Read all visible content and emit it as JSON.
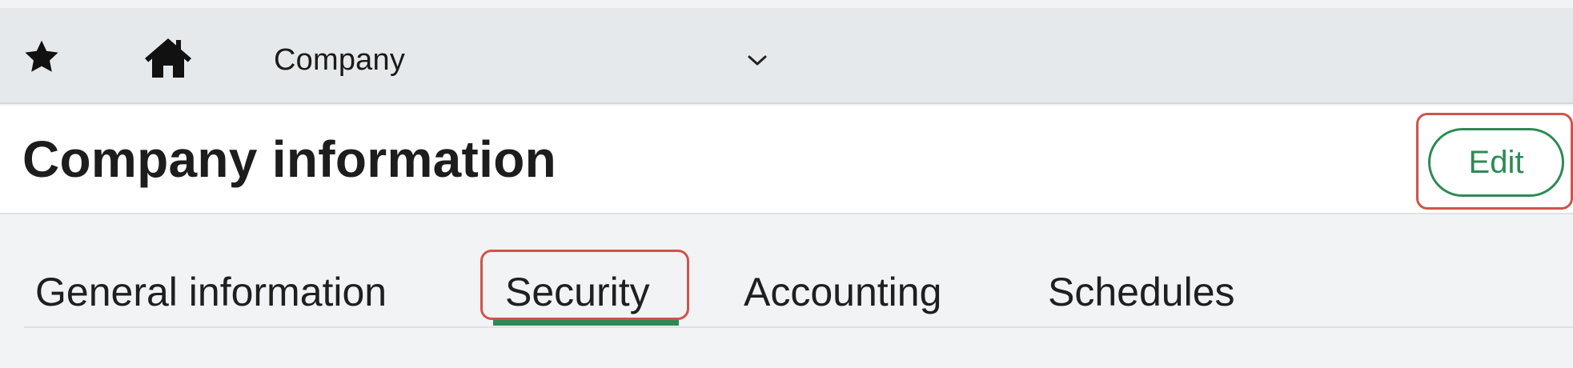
{
  "topbar": {
    "favorite_icon": "star-icon",
    "home_icon": "home-icon",
    "context_label": "Company",
    "dropdown_icon": "chevron-down-icon"
  },
  "header": {
    "title": "Company information",
    "edit_label": "Edit"
  },
  "tabs": [
    {
      "label": "General information",
      "active": false
    },
    {
      "label": "Security",
      "active": true
    },
    {
      "label": "Accounting",
      "active": false
    },
    {
      "label": "Schedules",
      "active": false
    }
  ],
  "colors": {
    "accent": "#2e8a56",
    "highlight": "#d0534b",
    "topbar_bg": "#e6e9eb",
    "page_bg": "#f1f3f4"
  }
}
